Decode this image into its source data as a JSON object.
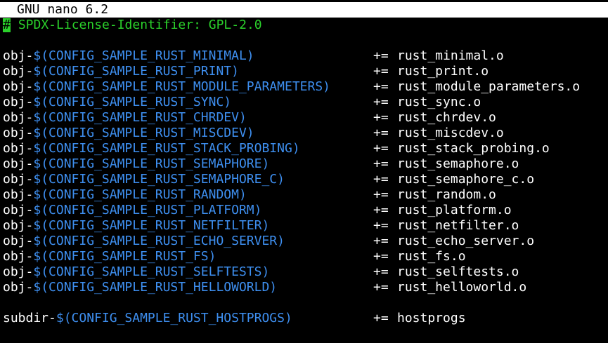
{
  "window": {
    "title": "GNU nano 6.2"
  },
  "colors": {
    "background": "#000000",
    "titlebar_bg": "#ffffff",
    "comment": "#2bd12b",
    "variable": "#3e8ff0",
    "text": "#ffffff",
    "cursor": "#2bd12b"
  },
  "editor": {
    "cursor_char": "#",
    "header_comment": " SPDX-License-Identifier: GPL-2.0",
    "obj_lines": [
      {
        "prefix": "obj-",
        "var": "$(CONFIG_SAMPLE_RUST_MINIMAL)",
        "op": "+=",
        "target": "rust_minimal.o"
      },
      {
        "prefix": "obj-",
        "var": "$(CONFIG_SAMPLE_RUST_PRINT)",
        "op": "+=",
        "target": "rust_print.o"
      },
      {
        "prefix": "obj-",
        "var": "$(CONFIG_SAMPLE_RUST_MODULE_PARAMETERS)",
        "op": "+=",
        "target": "rust_module_parameters.o"
      },
      {
        "prefix": "obj-",
        "var": "$(CONFIG_SAMPLE_RUST_SYNC)",
        "op": "+=",
        "target": "rust_sync.o"
      },
      {
        "prefix": "obj-",
        "var": "$(CONFIG_SAMPLE_RUST_CHRDEV)",
        "op": "+=",
        "target": "rust_chrdev.o"
      },
      {
        "prefix": "obj-",
        "var": "$(CONFIG_SAMPLE_RUST_MISCDEV)",
        "op": "+=",
        "target": "rust_miscdev.o"
      },
      {
        "prefix": "obj-",
        "var": "$(CONFIG_SAMPLE_RUST_STACK_PROBING)",
        "op": "+=",
        "target": "rust_stack_probing.o"
      },
      {
        "prefix": "obj-",
        "var": "$(CONFIG_SAMPLE_RUST_SEMAPHORE)",
        "op": "+=",
        "target": "rust_semaphore.o"
      },
      {
        "prefix": "obj-",
        "var": "$(CONFIG_SAMPLE_RUST_SEMAPHORE_C)",
        "op": "+=",
        "target": "rust_semaphore_c.o"
      },
      {
        "prefix": "obj-",
        "var": "$(CONFIG_SAMPLE_RUST_RANDOM)",
        "op": "+=",
        "target": "rust_random.o"
      },
      {
        "prefix": "obj-",
        "var": "$(CONFIG_SAMPLE_RUST_PLATFORM)",
        "op": "+=",
        "target": "rust_platform.o"
      },
      {
        "prefix": "obj-",
        "var": "$(CONFIG_SAMPLE_RUST_NETFILTER)",
        "op": "+=",
        "target": "rust_netfilter.o"
      },
      {
        "prefix": "obj-",
        "var": "$(CONFIG_SAMPLE_RUST_ECHO_SERVER)",
        "op": "+=",
        "target": "rust_echo_server.o"
      },
      {
        "prefix": "obj-",
        "var": "$(CONFIG_SAMPLE_RUST_FS)",
        "op": "+=",
        "target": "rust_fs.o"
      },
      {
        "prefix": "obj-",
        "var": "$(CONFIG_SAMPLE_RUST_SELFTESTS)",
        "op": "+=",
        "target": "rust_selftests.o"
      },
      {
        "prefix": "obj-",
        "var": "$(CONFIG_SAMPLE_RUST_HELLOWORLD)",
        "op": "+=",
        "target": "rust_helloworld.o"
      }
    ],
    "subdir_line": {
      "prefix": "subdir-",
      "var": "$(CONFIG_SAMPLE_RUST_HOSTPROGS)",
      "op": "+=",
      "target": "hostprogs"
    }
  }
}
